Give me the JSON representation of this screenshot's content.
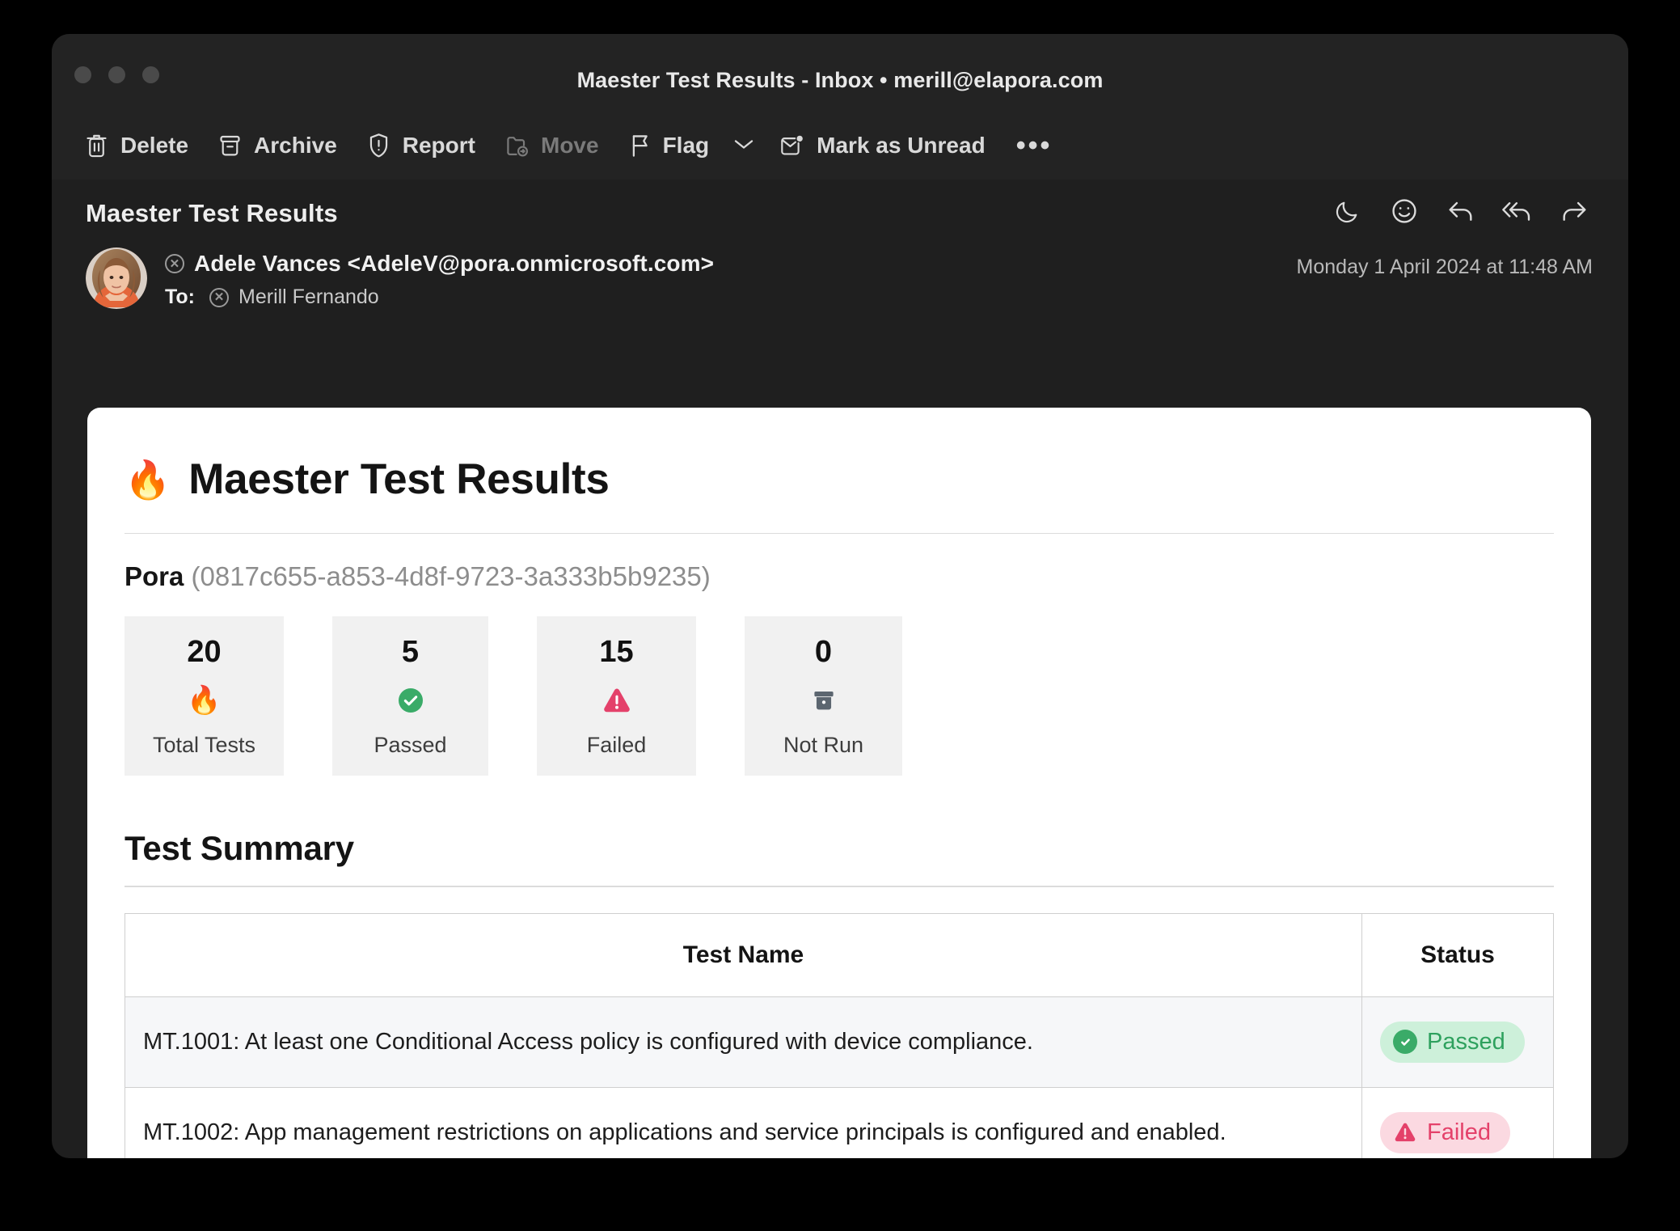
{
  "window": {
    "title": "Maester Test Results - Inbox • merill@elapora.com",
    "traffic_lights": [
      "close",
      "minimize",
      "zoom"
    ]
  },
  "toolbar": {
    "items": [
      {
        "label": "Delete",
        "icon": "trash-icon",
        "disabled": false
      },
      {
        "label": "Archive",
        "icon": "archive-box-icon",
        "disabled": false
      },
      {
        "label": "Report",
        "icon": "shield-exclamation-icon",
        "disabled": false
      },
      {
        "label": "Move",
        "icon": "folder-move-icon",
        "disabled": true
      },
      {
        "label": "Flag",
        "icon": "flag-icon",
        "disabled": false
      },
      {
        "label": "Mark as Unread",
        "icon": "envelope-unread-icon",
        "disabled": false
      }
    ],
    "overflow_label": "•••"
  },
  "message": {
    "subject": "Maester Test Results",
    "sender_name": "Adele Vances",
    "sender_email": "<AdeleV@pora.onmicrosoft.com>",
    "sender_display": "Adele Vances <AdeleV@pora.onmicrosoft.com>",
    "to_label": "To:",
    "to_recipient": "Merill Fernando",
    "date": "Monday 1 April 2024 at 11:48 AM",
    "actions": [
      "snooze-moon-icon",
      "react-smiley-icon",
      "reply-icon",
      "reply-all-icon",
      "forward-icon"
    ]
  },
  "report": {
    "brand_icon": "🔥",
    "brand_title": "Maester Test Results",
    "tenant_name": "Pora",
    "tenant_id": "(0817c655-a853-4d8f-9723-3a333b5b9235)",
    "stats": [
      {
        "value": "20",
        "label": "Total Tests",
        "icon": "flame-icon"
      },
      {
        "value": "5",
        "label": "Passed",
        "icon": "check-circle-icon"
      },
      {
        "value": "15",
        "label": "Failed",
        "icon": "warning-triangle-icon"
      },
      {
        "value": "0",
        "label": "Not Run",
        "icon": "archive-box-icon"
      }
    ],
    "summary_title": "Test Summary",
    "table": {
      "headers": [
        "Test Name",
        "Status"
      ],
      "rows": [
        {
          "name": "MT.1001: At least one Conditional Access policy is configured with device compliance.",
          "status": "Passed"
        },
        {
          "name": "MT.1002: App management restrictions on applications and service principals is configured and enabled.",
          "status": "Failed"
        },
        {
          "name": "",
          "status": ""
        }
      ]
    }
  },
  "colors": {
    "pass_text": "#2ea15e",
    "pass_bg": "#cdf0da",
    "fail_text": "#e4416a",
    "fail_bg": "#fbd9e1",
    "window_bg": "#232323",
    "card_bg": "#ffffff"
  }
}
